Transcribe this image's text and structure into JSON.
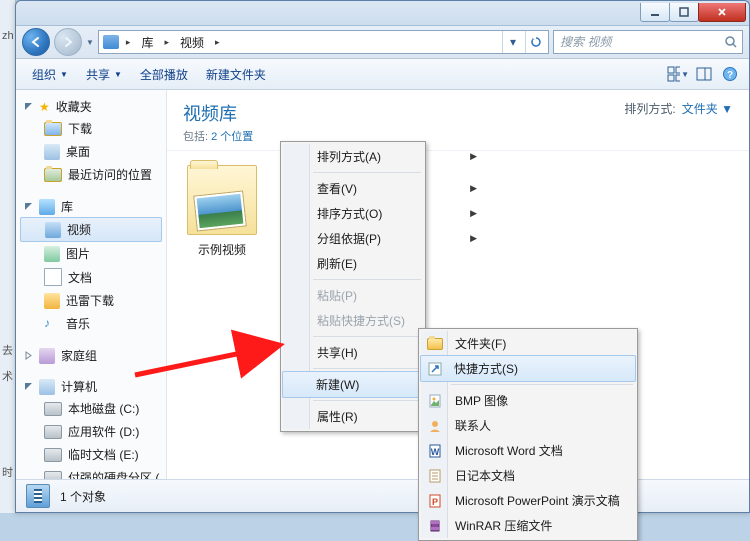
{
  "window_controls": {
    "min_tooltip": "最小化",
    "max_tooltip": "最大化",
    "close_tooltip": "关闭"
  },
  "breadcrumb": {
    "root": "库",
    "item": "视频"
  },
  "search": {
    "placeholder": "搜索 视频"
  },
  "toolbar": {
    "organize": "组织",
    "organize_dd": "▼",
    "share": "共享",
    "share_dd": "▼",
    "playall": "全部播放",
    "newfolder": "新建文件夹"
  },
  "sidebar": {
    "favorites": {
      "label": "收藏夹",
      "items": [
        "下载",
        "桌面",
        "最近访问的位置"
      ]
    },
    "libraries": {
      "label": "库",
      "items": [
        "视频",
        "图片",
        "文档",
        "迅雷下载",
        "音乐"
      ]
    },
    "homegroup": {
      "label": "家庭组"
    },
    "computer": {
      "label": "计算机",
      "items": [
        "本地磁盘 (C:)",
        "应用软件 (D:)",
        "临时文档 (E:)",
        "付强的硬盘分区 ("
      ]
    }
  },
  "library": {
    "title": "视频库",
    "includes_pre": "包括: ",
    "includes_link": "2 个位置",
    "sort_label": "排列方式:",
    "sort_value": "文件夹"
  },
  "files": {
    "sample": "示例视频"
  },
  "ctx_main": {
    "sort": "排列方式(A)",
    "view": "查看(V)",
    "sortby": "排序方式(O)",
    "groupby": "分组依据(P)",
    "refresh": "刷新(E)",
    "paste": "粘贴(P)",
    "paste_shortcut": "粘贴快捷方式(S)",
    "share": "共享(H)",
    "new": "新建(W)",
    "properties": "属性(R)"
  },
  "ctx_sub": {
    "folder": "文件夹(F)",
    "shortcut": "快捷方式(S)",
    "bmp": "BMP 图像",
    "contact": "联系人",
    "word": "Microsoft Word 文档",
    "journal": "日记本文档",
    "ppt": "Microsoft PowerPoint 演示文稿",
    "rar": "WinRAR 压缩文件"
  },
  "status": {
    "text": "1 个对象"
  },
  "left_edge": [
    "zh",
    "",
    "",
    "去",
    "术",
    "",
    "时"
  ]
}
